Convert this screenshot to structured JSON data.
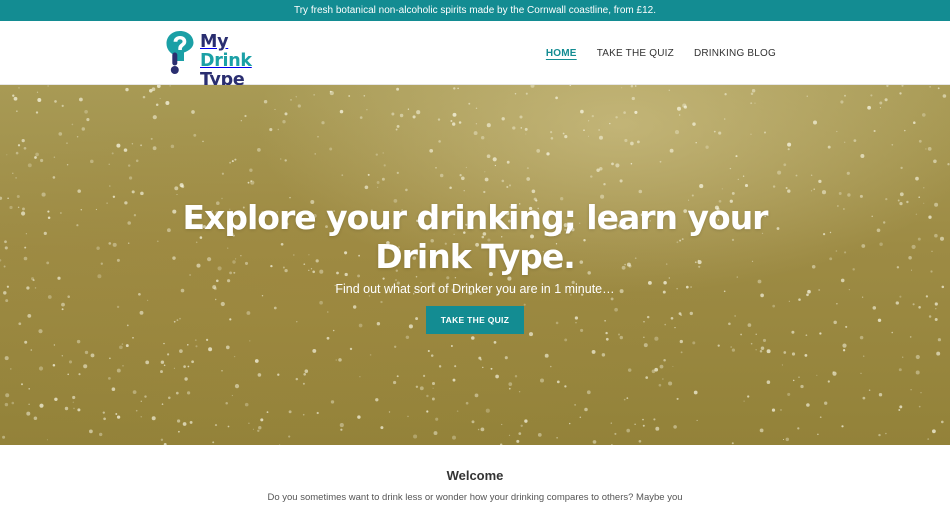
{
  "promo_bar": {
    "text": "Try fresh botanical non-alcoholic spirits made by the Cornwall coastline, from £12."
  },
  "header": {
    "logo": {
      "icon": "question-mark-droplet-icon",
      "word_my": "My",
      "word_drink": "Drink",
      "word_type": "Type",
      "color_dark": "#2a2e70",
      "color_teal": "#1ba0a6"
    },
    "nav": [
      {
        "label": "HOME",
        "active": true
      },
      {
        "label": "TAKE THE QUIZ",
        "active": false
      },
      {
        "label": "DRINKING BLOG",
        "active": false
      }
    ]
  },
  "hero": {
    "title_line1": "Explore your drinking; learn your",
    "title_line2": "Drink Type.",
    "subtitle": "Find out what sort of Drinker you are in 1 minute…",
    "button_label": "TAKE THE QUIZ",
    "background": "sparkling-drink-bubbles"
  },
  "welcome": {
    "title": "Welcome",
    "text": "Do you sometimes want to drink less or wonder how your drinking compares to others?  Maybe you"
  },
  "colors": {
    "brand_teal": "#138c92",
    "hero_gold": "#9d8b44"
  }
}
